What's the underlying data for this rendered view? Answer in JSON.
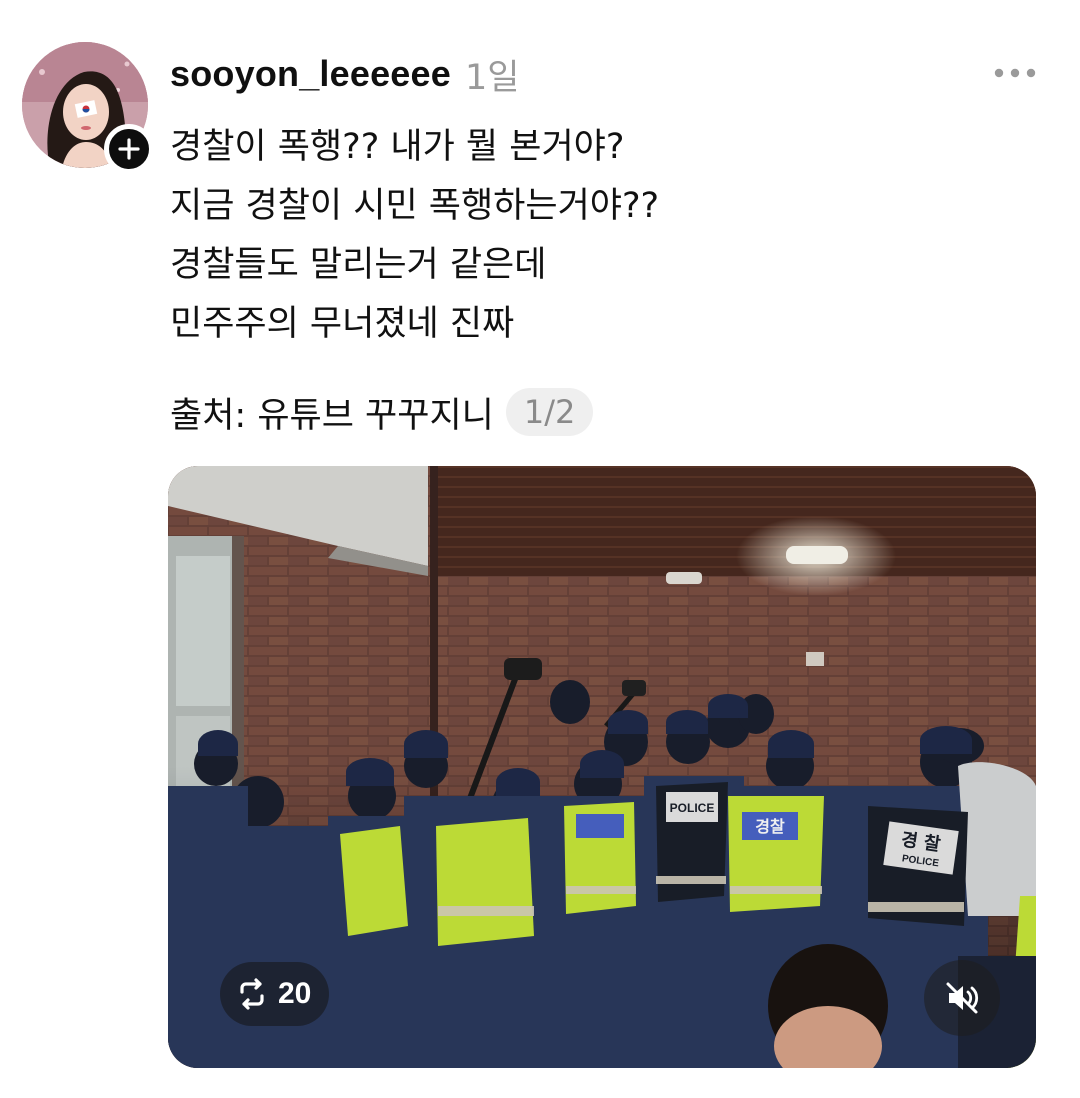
{
  "post": {
    "username": "sooyon_leeeeee",
    "timestamp": "1일",
    "lines": [
      "경찰이 폭행?? 내가 뭘 본거야?",
      "지금 경찰이 시민 폭행하는거야??",
      "경찰들도 말리는거 같은데",
      "민주주의 무너졌네 진짜"
    ],
    "source": "출처: 유튜브 꾸꾸지니",
    "page_indicator": "1/2",
    "repost_count": "20"
  },
  "icons": {
    "follow": "plus-icon",
    "more": "more-horizontal-icon",
    "repost": "repost-icon",
    "mute": "speaker-muted-icon"
  },
  "video_labels": {
    "vest_1": "POLICE",
    "vest_2": "경찰",
    "vest_3": "경 찰",
    "vest_3_sub": "POLICE"
  },
  "colors": {
    "text": "#111111",
    "muted": "#9a9a9a",
    "pill_bg": "#efefef",
    "vest": "#c8e83a"
  }
}
